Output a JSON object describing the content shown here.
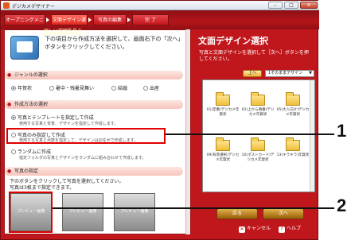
{
  "window": {
    "title": "デジカメデザイナー",
    "controls": {
      "minimize": "–",
      "maximize": "□",
      "close": "✕"
    }
  },
  "steps": [
    {
      "label": "オープニングメニュー"
    },
    {
      "label": "文面デザイン選択"
    },
    {
      "label": "写真の編集"
    },
    {
      "label": "完 了"
    }
  ],
  "intro": {
    "text": "下の項目から作成方法を選択して、画面右下の「次へ」ボタンをクリックしてください。"
  },
  "genre": {
    "heading": "ジャンルの選択",
    "options": [
      "年賀状",
      "暑中・残暑見舞い",
      "結婚",
      "出産"
    ]
  },
  "method": {
    "heading": "作成方法の選択",
    "options": [
      {
        "label": "写真とテンプレートを指定して作成",
        "sub": "使用する写真と背景、デザインを指定して作成します。"
      },
      {
        "label": "写真のみ指定して作成",
        "sub": "使用する写真と点数を指定して、デザインはお任せで作成します。"
      },
      {
        "label": "ランダムに作成",
        "sub": "指定フォルダの写真とデザインをランダムに組み合わせて作成します。"
      }
    ]
  },
  "photo": {
    "heading": "写真の指定",
    "note_1": "下のボタンをクリックして写真を選択してください。",
    "note_2": "写真は3枚まで指定できます。",
    "previews": [
      "プレビュー画像",
      "プレビュー画像",
      "プレビュー画像"
    ]
  },
  "right": {
    "title": "文面デザイン選択",
    "desc": "写真と文面デザインを選択して［次へ］ボタンを押してください。",
    "link": "詳しい説明を見る",
    "up_label": "上へ",
    "dropdown_value": "1そのままデザイン",
    "items": [
      "01(定番)デジカメ年賀状",
      "02(上から順番)デジカメ年賀状",
      "05(大人向け)デジカメ年賀状",
      "09(背景選択)デジカメ年賀状",
      "10(ポストカード)デジカメ年賀状",
      "13(キラキラ)年賀状"
    ]
  },
  "footer": {
    "back": "戻る",
    "next": "次へ",
    "cancel": "キャンセル",
    "help": "ヘルプ"
  },
  "callouts": [
    "1",
    "2"
  ]
}
